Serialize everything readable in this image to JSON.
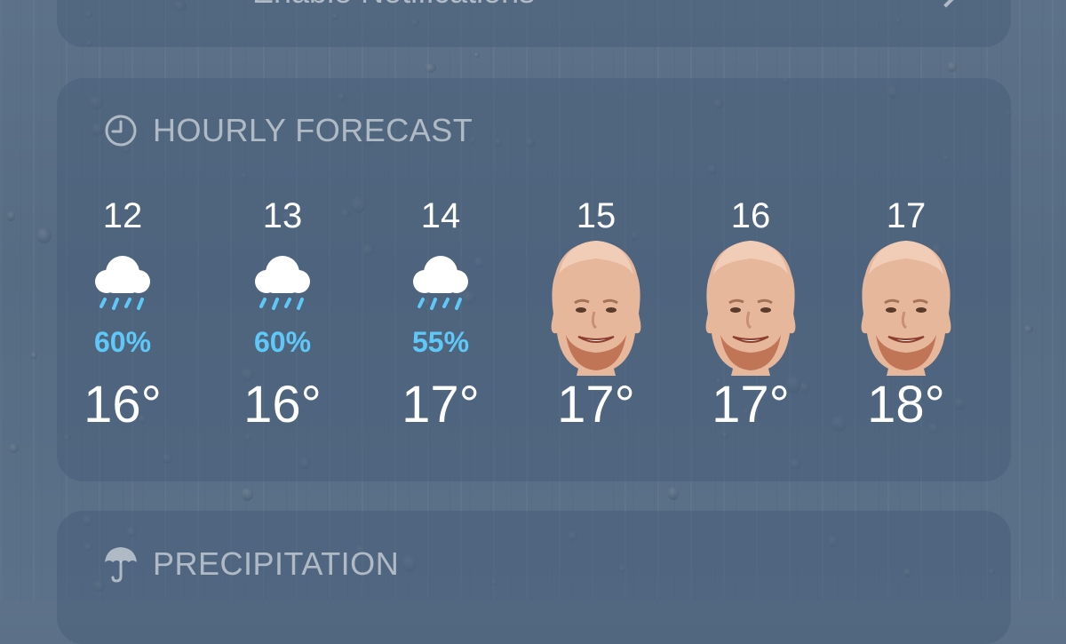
{
  "notifications": {
    "label": "Enable Notifications"
  },
  "hourly": {
    "title": "HOURLY FORECAST",
    "hours": [
      {
        "time": "12",
        "icon": "rain-cloud-icon",
        "precip": "60%",
        "temp": "16°"
      },
      {
        "time": "13",
        "icon": "rain-cloud-icon",
        "precip": "60%",
        "temp": "16°"
      },
      {
        "time": "14",
        "icon": "rain-cloud-icon",
        "precip": "55%",
        "temp": "17°"
      },
      {
        "time": "15",
        "icon": "face-photo-icon",
        "precip": "",
        "temp": "17°"
      },
      {
        "time": "16",
        "icon": "face-photo-icon",
        "precip": "",
        "temp": "17°"
      },
      {
        "time": "17",
        "icon": "face-photo-icon",
        "precip": "",
        "temp": "18°"
      }
    ]
  },
  "precipitation": {
    "title": "PRECIPITATION"
  },
  "colors": {
    "precip_blue": "#5ec8f8",
    "card_bg": "#485e7a",
    "background": "#5a6f86"
  }
}
